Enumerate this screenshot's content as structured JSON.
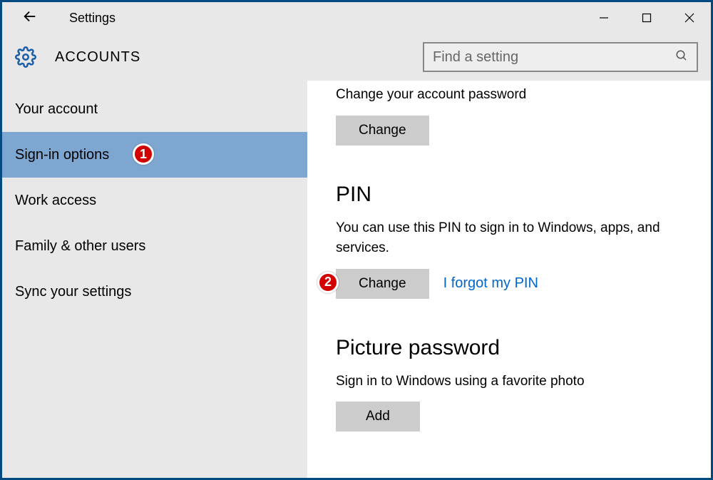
{
  "window": {
    "title": "Settings"
  },
  "header": {
    "section": "ACCOUNTS",
    "search_placeholder": "Find a setting"
  },
  "sidebar": {
    "items": [
      {
        "label": "Your account"
      },
      {
        "label": "Sign-in options"
      },
      {
        "label": "Work access"
      },
      {
        "label": "Family & other users"
      },
      {
        "label": "Sync your settings"
      }
    ],
    "selected_index": 1
  },
  "content": {
    "password_desc": "Change your account password",
    "password_btn": "Change",
    "pin_title": "PIN",
    "pin_desc": "You can use this PIN to sign in to Windows, apps, and services.",
    "pin_btn": "Change",
    "pin_link": "I forgot my PIN",
    "picture_title": "Picture password",
    "picture_desc": "Sign in to Windows using a favorite photo",
    "picture_btn": "Add"
  },
  "callouts": {
    "one": "1",
    "two": "2"
  }
}
